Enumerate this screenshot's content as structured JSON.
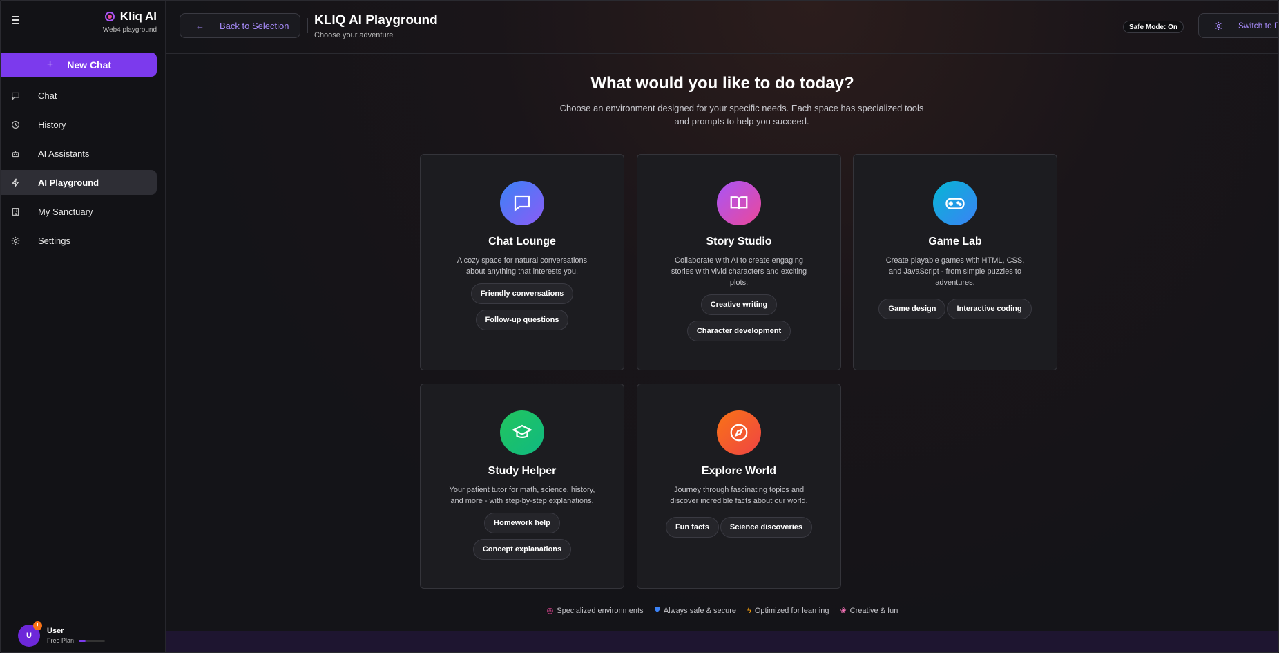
{
  "sidebar": {
    "brand_name": "Kliq AI",
    "brand_subtitle": "Web4 playground",
    "new_chat_label": "New Chat",
    "items": [
      {
        "label": "Chat",
        "icon": "chat-bubble-icon"
      },
      {
        "label": "History",
        "icon": "history-icon"
      },
      {
        "label": "AI Assistants",
        "icon": "robot-icon"
      },
      {
        "label": "AI Playground",
        "icon": "lightning-icon",
        "active": true
      },
      {
        "label": "My Sanctuary",
        "icon": "building-icon"
      },
      {
        "label": "Settings",
        "icon": "gear-icon"
      }
    ],
    "user": {
      "initial": "U",
      "name": "User",
      "plan": "Free Plan",
      "badge": "!",
      "plan_progress": 0.25
    }
  },
  "header": {
    "back_label": "Back to Selection",
    "title": "KLIQ AI Playground",
    "subtitle": "Choose your adventure",
    "safe_mode": "Safe Mode: On",
    "switch_label": "Switch to Pro"
  },
  "hero": {
    "title": "What would you like to do today?",
    "subtitle": "Choose an environment designed for your specific needs. Each space has specialized tools and prompts to help you succeed."
  },
  "cards": [
    {
      "title": "Chat Lounge",
      "desc": "A cozy space for natural conversations about anything that interests you.",
      "tags": [
        "Friendly conversations",
        "Follow-up questions"
      ],
      "icon": "chat-bubble-icon",
      "color_from": "#3b82f6",
      "color_to": "#8b5cf6"
    },
    {
      "title": "Story Studio",
      "desc": "Collaborate with AI to create engaging stories with vivid characters and exciting plots.",
      "tags": [
        "Creative writing",
        "Character development"
      ],
      "icon": "book-icon",
      "color_from": "#a855f7",
      "color_to": "#ec4899"
    },
    {
      "title": "Game Lab",
      "desc": "Create playable games with HTML, CSS, and JavaScript - from simple puzzles to adventures.",
      "tags": [
        "Game design",
        "Interactive coding"
      ],
      "icon": "gamepad-icon",
      "color_from": "#06b6d4",
      "color_to": "#3b82f6"
    },
    {
      "title": "Study Helper",
      "desc": "Your patient tutor for math, science, history, and more - with step-by-step explanations.",
      "tags": [
        "Homework help",
        "Concept explanations"
      ],
      "icon": "graduation-cap-icon",
      "color_from": "#22c55e",
      "color_to": "#10b981"
    },
    {
      "title": "Explore World",
      "desc": "Journey through fascinating topics and discover incredible facts about our world.",
      "tags": [
        "Fun facts",
        "Science discoveries"
      ],
      "icon": "compass-icon",
      "color_from": "#f97316",
      "color_to": "#ef4444"
    }
  ],
  "features": [
    {
      "label": "Specialized environments",
      "icon": "target-icon"
    },
    {
      "label": "Always safe & secure",
      "icon": "shield-icon"
    },
    {
      "label": "Optimized for learning",
      "icon": "lightning-icon"
    },
    {
      "label": "Creative & fun",
      "icon": "palette-icon"
    }
  ],
  "colors": {
    "accent": "#7c3aed",
    "accent_text": "#a78bfa",
    "background": "#141418",
    "sidebar": "#121216"
  }
}
